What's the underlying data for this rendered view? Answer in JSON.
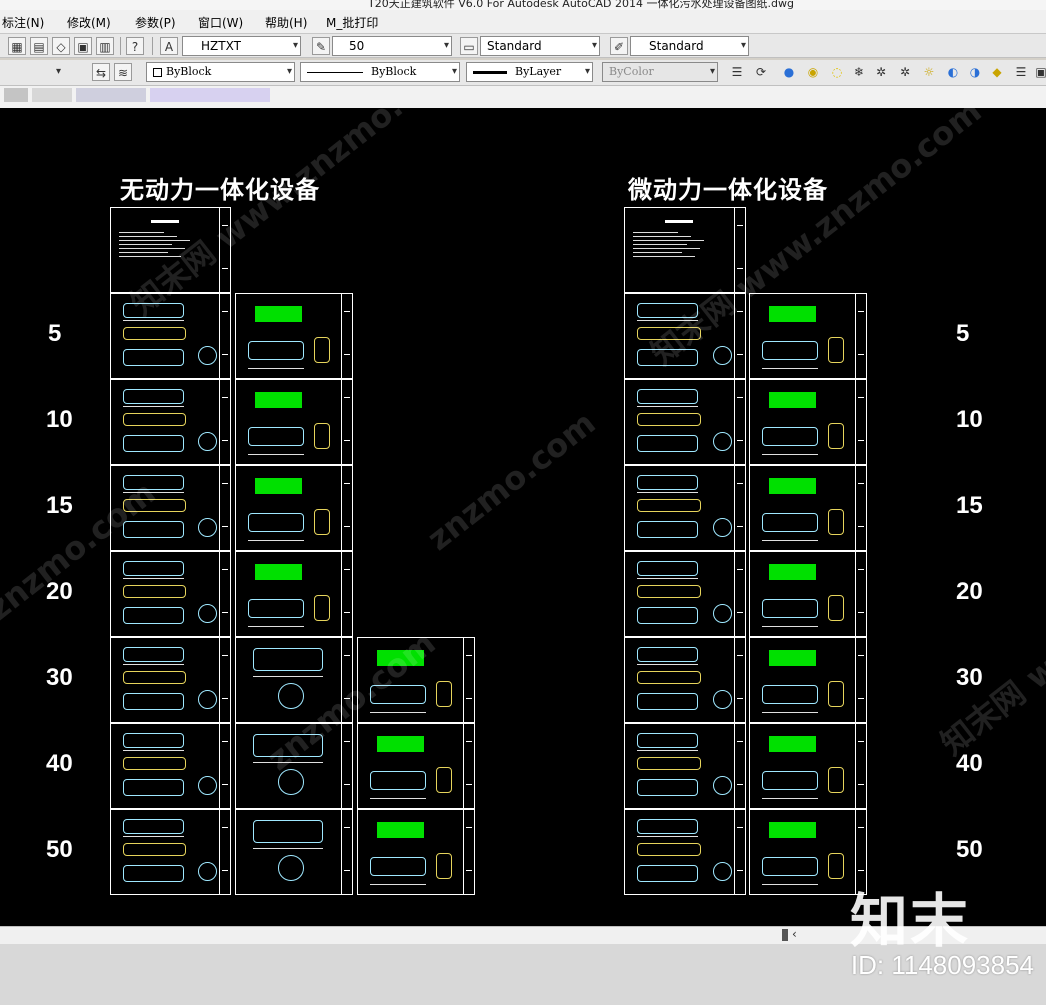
{
  "window": {
    "title": "T20天正建筑软件 V6.0 For Autodesk AutoCAD 2014      一体化污水处理设备图纸.dwg"
  },
  "menu": [
    {
      "label": "标注(N)"
    },
    {
      "label": "修改(M)"
    },
    {
      "label": "参数(P)"
    },
    {
      "label": "窗口(W)"
    },
    {
      "label": "帮助(H)"
    },
    {
      "label": "M_批打印"
    }
  ],
  "styles_toolbar": {
    "text_style": "HZTXT",
    "text_height": "50",
    "dim_style": "Standard",
    "table_style": "Standard"
  },
  "properties_toolbar": {
    "color": "ByBlock",
    "linetype": "ByBlock",
    "lineweight": "ByLayer",
    "plot_style": "ByColor"
  },
  "drawing": {
    "left_title": "无动力一体化设备",
    "right_title": "微动力一体化设备",
    "left_rows": [
      "5",
      "10",
      "15",
      "20",
      "30",
      "40",
      "50"
    ],
    "right_rows": [
      "5",
      "10",
      "15",
      "20",
      "30",
      "40",
      "50"
    ],
    "watermark_text": "znzmo.com",
    "watermark_cn": "知末网 www.znzmo.com"
  },
  "footer": {
    "brand": "知末",
    "id_text": "ID: 1148093854"
  }
}
